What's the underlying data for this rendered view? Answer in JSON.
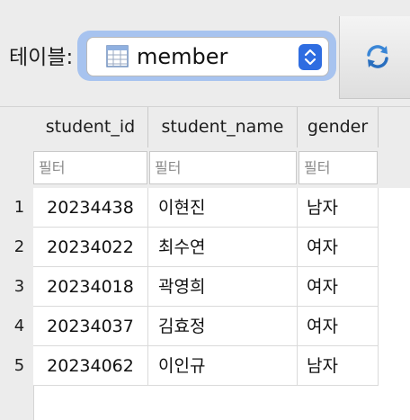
{
  "toolbar": {
    "table_label": "테이블:",
    "selected_table": "member",
    "table_icon": "table-grid-icon",
    "stepper_icon": "up-down-chevron-icon",
    "refresh_icon": "refresh-icon"
  },
  "grid": {
    "columns": [
      {
        "label": "student_id"
      },
      {
        "label": "student_name"
      },
      {
        "label": "gender"
      }
    ],
    "filter_placeholder": "필터",
    "rows": [
      {
        "num": "1",
        "student_id": "20234438",
        "student_name": "이현진",
        "gender": "남자"
      },
      {
        "num": "2",
        "student_id": "20234022",
        "student_name": "최수연",
        "gender": "여자"
      },
      {
        "num": "3",
        "student_id": "20234018",
        "student_name": "곽영희",
        "gender": "여자"
      },
      {
        "num": "4",
        "student_id": "20234037",
        "student_name": "김효정",
        "gender": "여자"
      },
      {
        "num": "5",
        "student_id": "20234062",
        "student_name": "이인규",
        "gender": "남자"
      }
    ]
  },
  "colors": {
    "accent": "#2f6de1",
    "focus_ring": "#a7c3ef",
    "toolbar_bg": "#ececec"
  }
}
